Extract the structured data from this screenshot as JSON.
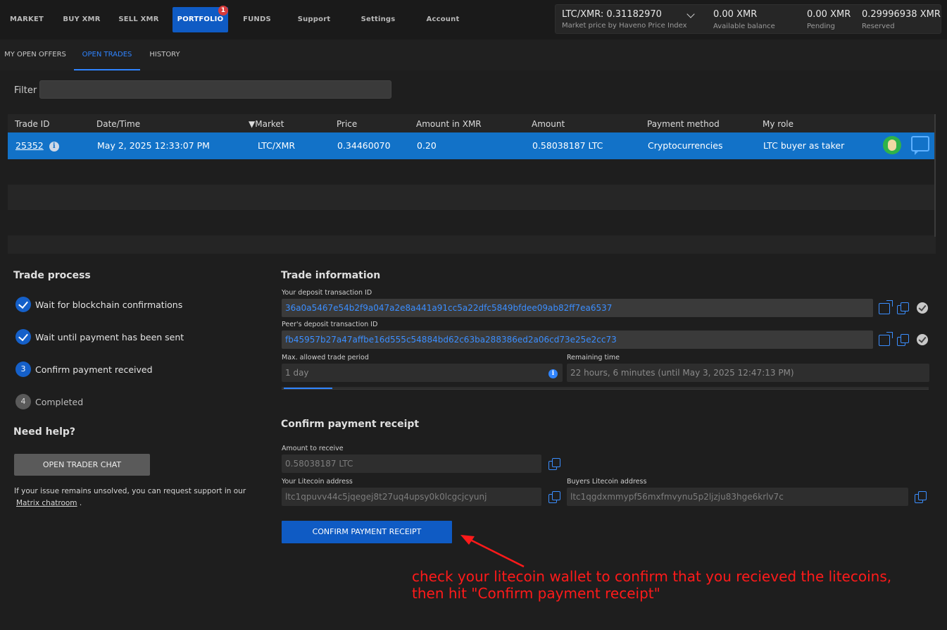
{
  "nav": {
    "items": [
      "MARKET",
      "BUY XMR",
      "SELL XMR",
      "PORTFOLIO",
      "FUNDS",
      "Support",
      "Settings",
      "Account"
    ],
    "active": "PORTFOLIO",
    "portfolio_badge": "1"
  },
  "market_info": {
    "pair_price": "LTC/XMR: 0.31182970",
    "price_source": "Market price by Haveno Price Index",
    "available_value": "0.00 XMR",
    "available_label": "Available balance",
    "pending_value": "0.00 XMR",
    "pending_label": "Pending",
    "reserved_value": "0.29996938 XMR",
    "reserved_label": "Reserved"
  },
  "subtabs": [
    "MY OPEN OFFERS",
    "OPEN TRADES",
    "HISTORY"
  ],
  "filter": {
    "label": "Filter",
    "value": ""
  },
  "table": {
    "headers": [
      "Trade ID",
      "Date/Time",
      "Market",
      "Price",
      "Amount in XMR",
      "Amount",
      "Payment method",
      "My role"
    ],
    "sort_column": "Market",
    "row": {
      "trade_id": "25352",
      "date": "May 2, 2025 12:33:07 PM",
      "market": "LTC/XMR",
      "price": "0.34460070",
      "amount_xmr": "0.20",
      "amount": "0.58038187 LTC",
      "payment_method": "Cryptocurrencies",
      "role": "LTC buyer as taker"
    }
  },
  "trade_process": {
    "title": "Trade process",
    "steps": [
      {
        "label": "Wait for blockchain confirmations",
        "state": "done",
        "number": "1"
      },
      {
        "label": "Wait until payment has been sent",
        "state": "done",
        "number": "2"
      },
      {
        "label": "Confirm payment received",
        "state": "current",
        "number": "3"
      },
      {
        "label": "Completed",
        "state": "todo",
        "number": "4"
      }
    ],
    "help_title": "Need help?",
    "chat_button": "OPEN TRADER CHAT",
    "help_text": "If your issue remains unsolved, you can request support in our",
    "help_link": "Matrix chatroom",
    "help_suffix": "."
  },
  "trade_info": {
    "title": "Trade information",
    "deposit_label": "Your deposit transaction ID",
    "deposit_value": "36a0a5467e54b2f9a047a2e8a441a91cc5a22dfc5849bfdee09ab82ff7ea6537",
    "peer_label": "Peer's deposit transaction ID",
    "peer_value": "fb45957b27a47affbe16d555c54884bd62c63ba288386ed2a06cd73e25e2cc73",
    "max_period_label": "Max. allowed trade period",
    "max_period_value": "1 day",
    "remaining_label": "Remaining time",
    "remaining_value": "22 hours, 6 minutes (until May 3, 2025 12:47:13 PM)",
    "elapsed_fraction": 0.075
  },
  "confirm": {
    "title": "Confirm payment receipt",
    "amount_label": "Amount to receive",
    "amount_value": "0.58038187 LTC",
    "your_addr_label": "Your Litecoin address",
    "your_addr_value": "ltc1qpuvv44c5jqegej8t27uq4upsy0k0lcgcjcyunj",
    "buyer_addr_label": "Buyers Litecoin address",
    "buyer_addr_value": "ltc1qgdxmmypf56mxfmvynu5p2ljzju83hge6krlv7c",
    "button": "CONFIRM PAYMENT RECEIPT"
  },
  "annotation": {
    "line1": "check your litecoin wallet to confirm that you recieved the litecoins,",
    "line2": "then hit \"Confirm payment receipt\"",
    "color": "#ff1a1a"
  },
  "colors": {
    "accent": "#0f5bc4",
    "selected_row": "#1272c8",
    "link": "#3b8eff"
  }
}
